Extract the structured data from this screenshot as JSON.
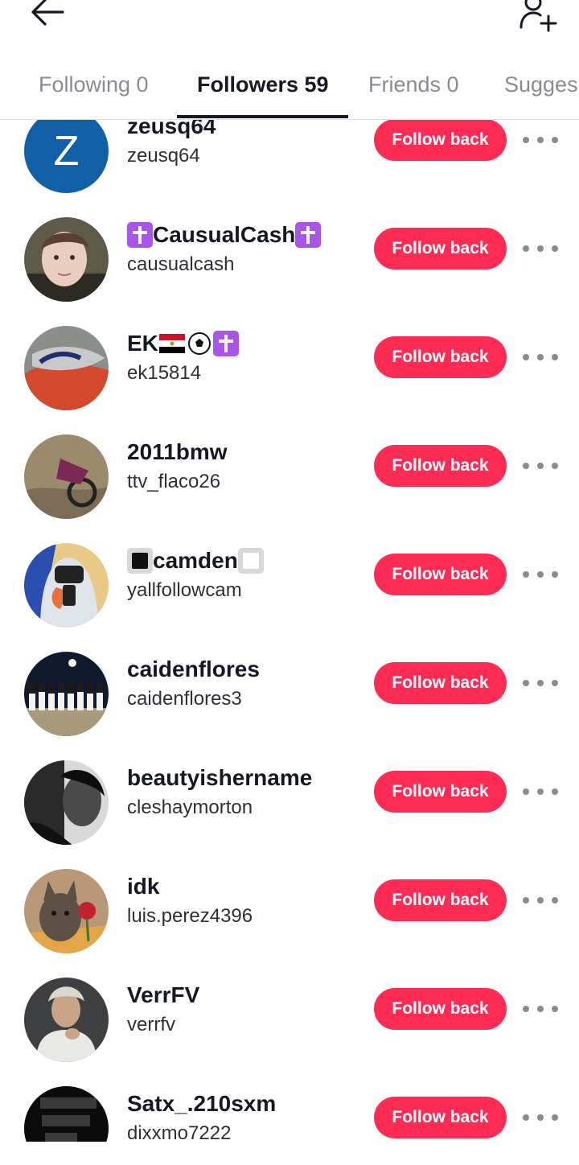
{
  "header": {
    "back_icon": "arrow-left-icon",
    "add_friend_icon": "person-add-icon"
  },
  "tabs": [
    {
      "label": "Following 0",
      "active": false
    },
    {
      "label": "Followers 59",
      "active": true
    },
    {
      "label": "Friends 0",
      "active": false
    },
    {
      "label": "Sugges",
      "active": false
    }
  ],
  "follow_button_label": "Follow back",
  "colors": {
    "accent": "#fe2c55",
    "text_primary": "#161823",
    "text_muted": "#8a8b91"
  },
  "followers": [
    {
      "display_name": "zeusq64",
      "username": "zeusq64",
      "avatar_letter": "Z",
      "avatar_color": "#1160a7"
    },
    {
      "display_name": "CausualCash",
      "username": "causualcash",
      "decor_before": "latin-cross-emoji",
      "decor_after": "latin-cross-emoji"
    },
    {
      "display_name": "EK",
      "username": "ek15814",
      "decor_after": "egypt-flag-emoji soccer-ball-emoji latin-cross-emoji"
    },
    {
      "display_name": "2011bmw",
      "username": "ttv_flaco26"
    },
    {
      "display_name": "camden",
      "username": "yallfollowcam",
      "decor_before": "black-square-emoji",
      "decor_after": "white-square-emoji"
    },
    {
      "display_name": "caidenflores",
      "username": "caidenflores3"
    },
    {
      "display_name": "beautyishername",
      "username": "cleshaymorton"
    },
    {
      "display_name": "idk",
      "username": "luis.perez4396"
    },
    {
      "display_name": "VerrFV",
      "username": "verrfv"
    },
    {
      "display_name": "Satx_.210sxm",
      "username": "dixxmo7222"
    }
  ]
}
